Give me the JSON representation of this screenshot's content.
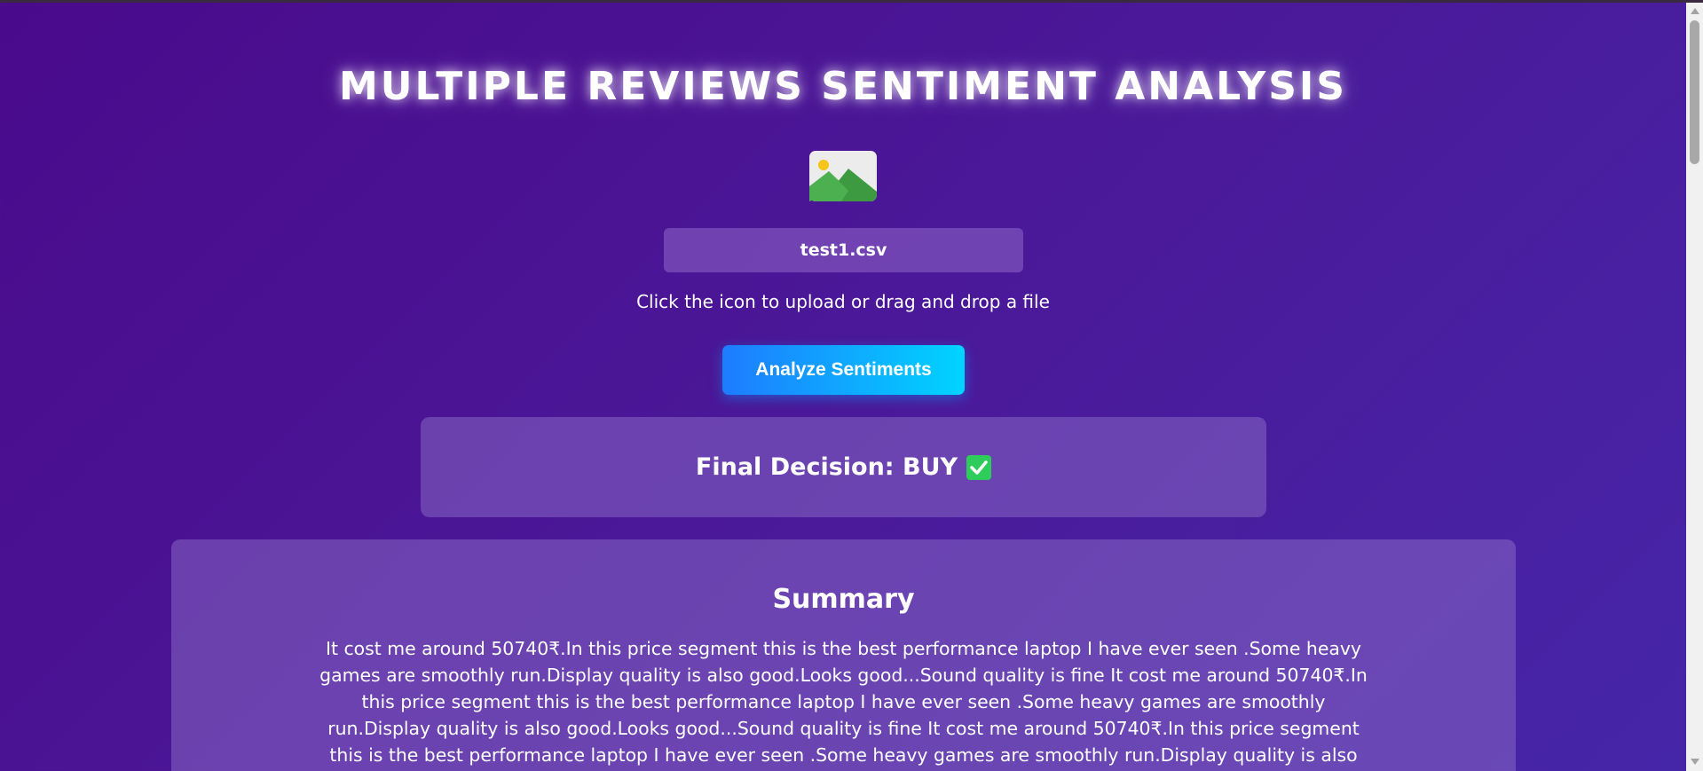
{
  "header": {
    "title": "MULTIPLE REVIEWS SENTIMENT ANALYSIS"
  },
  "upload": {
    "icon": "image-icon",
    "file_name": "test1.csv",
    "hint": "Click the icon to upload or drag and drop a file"
  },
  "actions": {
    "analyze_label": "Analyze Sentiments"
  },
  "decision": {
    "label": "Final Decision: BUY",
    "icon": "check-mark-icon",
    "icon_color": "#2ecc5a"
  },
  "summary": {
    "title": "Summary",
    "text": "It cost me around 50740₹.In this price segment this is the best performance laptop I have ever seen .Some heavy games are smoothly run.Display quality is also good.Looks good...Sound quality is fine It cost me around 50740₹.In this price segment this is the best performance laptop I have ever seen .Some heavy games are smoothly run.Display quality is also good.Looks good...Sound quality is fine It cost me around 50740₹.In this price segment this is the best performance laptop I have ever seen .Some heavy games are smoothly run.Display quality is also good.Looks"
  },
  "theme": {
    "background_start": "#4a0a8c",
    "background_end": "#4626a8",
    "button_gradient_start": "#1e7bff",
    "button_gradient_end": "#00d4ff"
  }
}
